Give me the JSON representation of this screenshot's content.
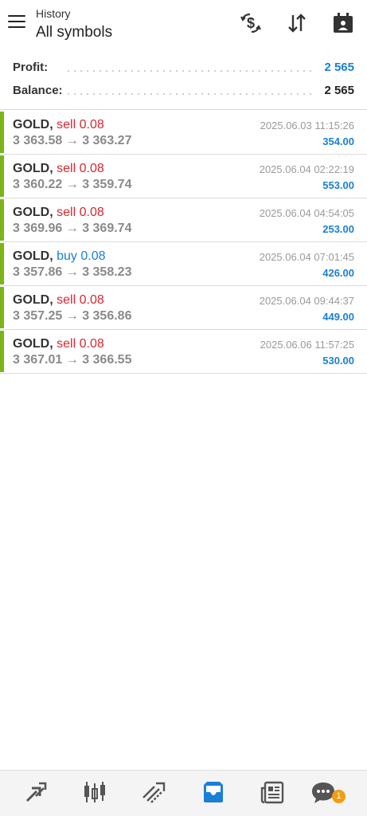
{
  "header": {
    "subtitle": "History",
    "title": "All symbols",
    "icons": [
      "currency-exchange-icon",
      "sort-icon",
      "calendar-icon"
    ]
  },
  "summary": {
    "profit_label": "Profit:",
    "profit_value": "2 565",
    "balance_label": "Balance:",
    "balance_value": "2 565"
  },
  "deals": [
    {
      "symbol": "GOLD,",
      "side": "sell",
      "volume": "0.08",
      "open": "3 363.58",
      "close": "3 363.27",
      "arrow": "→",
      "time": "2025.06.03 11:15:26",
      "profit": "354.00"
    },
    {
      "symbol": "GOLD,",
      "side": "sell",
      "volume": "0.08",
      "open": "3 360.22",
      "close": "3 359.74",
      "arrow": "→",
      "time": "2025.06.04 02:22:19",
      "profit": "553.00"
    },
    {
      "symbol": "GOLD,",
      "side": "sell",
      "volume": "0.08",
      "open": "3 369.96",
      "close": "3 369.74",
      "arrow": "→",
      "time": "2025.06.04 04:54:05",
      "profit": "253.00"
    },
    {
      "symbol": "GOLD,",
      "side": "buy",
      "volume": "0.08",
      "open": "3 357.86",
      "close": "3 358.23",
      "arrow": "→",
      "time": "2025.06.04 07:01:45",
      "profit": "426.00"
    },
    {
      "symbol": "GOLD,",
      "side": "sell",
      "volume": "0.08",
      "open": "3 357.25",
      "close": "3 356.86",
      "arrow": "→",
      "time": "2025.06.04 09:44:37",
      "profit": "449.00"
    },
    {
      "symbol": "GOLD,",
      "side": "sell",
      "volume": "0.08",
      "open": "3 367.01",
      "close": "3 366.55",
      "arrow": "→",
      "time": "2025.06.06 11:57:25",
      "profit": "530.00"
    }
  ],
  "colors": {
    "sell": "#d9272e",
    "buy": "#1a7fd6",
    "profit": "#1a7fd6",
    "accent_bar": "#7cb518",
    "active_nav": "#1a7fd6",
    "badge": "#f39c12"
  },
  "bottom_nav": {
    "items": [
      "quotes-icon",
      "chart-icon",
      "trade-icon",
      "history-icon",
      "news-icon",
      "messages-icon"
    ],
    "active": "history-icon",
    "badge_count": "1"
  }
}
